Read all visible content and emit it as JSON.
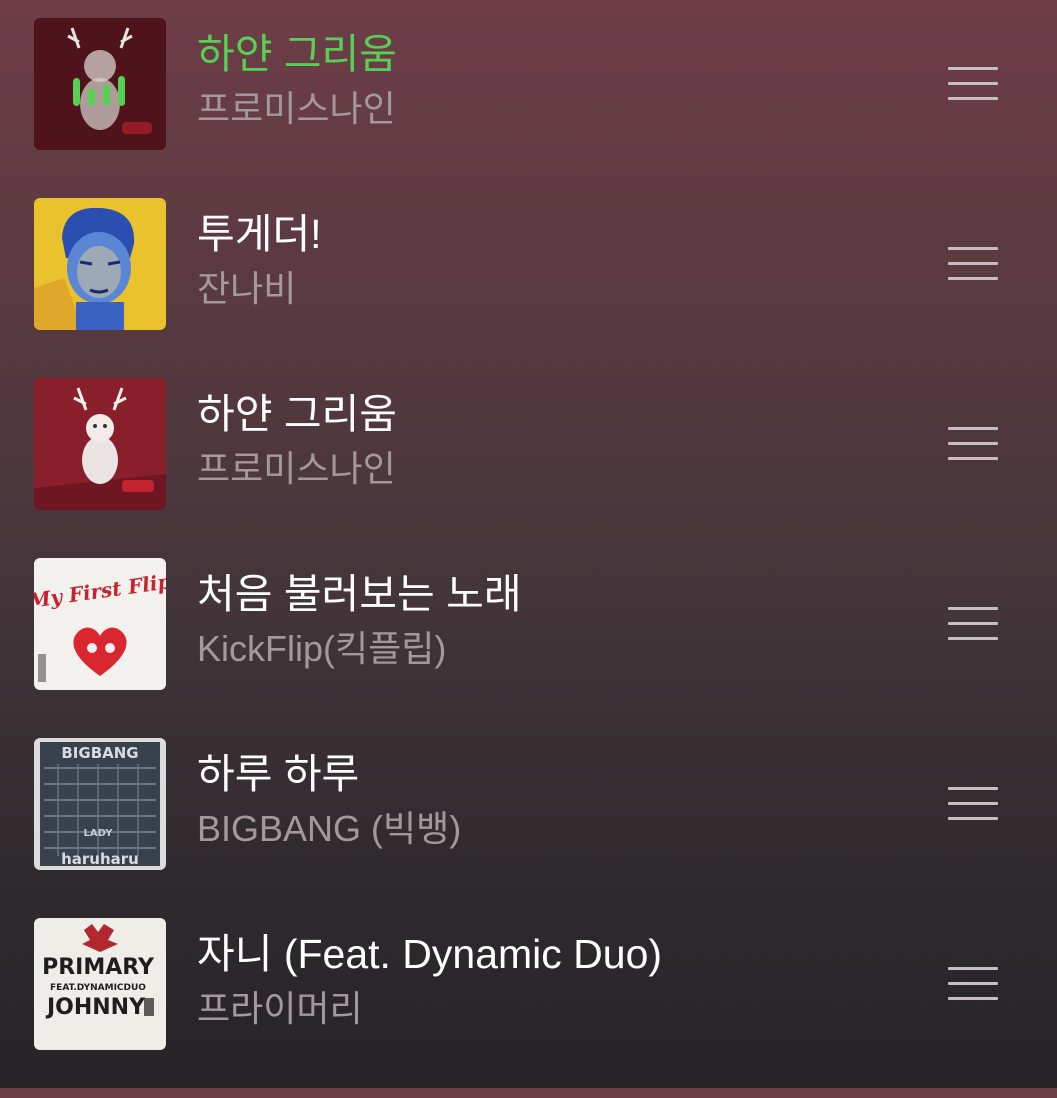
{
  "queue": {
    "items": [
      {
        "title": "하얀 그리움",
        "artist": "프로미스나인",
        "now_playing": true,
        "art": "white-cat-antlers-red"
      },
      {
        "title": "투게더!",
        "artist": "잔나비",
        "now_playing": false,
        "art": "blue-boy-painting-yellow"
      },
      {
        "title": "하얀 그리움",
        "artist": "프로미스나인",
        "now_playing": false,
        "art": "white-cat-antlers-red"
      },
      {
        "title": "처음 불러보는 노래",
        "artist": "KickFlip(킥플립)",
        "now_playing": false,
        "art": "red-skateboard-heart-white"
      },
      {
        "title": "하루 하루",
        "artist": "BIGBANG (빅뱅)",
        "now_playing": false,
        "art": "bigbang-haruharu-grey"
      },
      {
        "title": "자니 (Feat. Dynamic Duo)",
        "artist": "프라이머리",
        "now_playing": false,
        "art": "primary-johnny-white"
      }
    ],
    "art_text": {
      "item4_cover_text": "My First Flip",
      "item5_cover_top": "BIGBANG",
      "item5_cover_bottom": "haruharu",
      "item5_cover_middle": "LADY",
      "item6_cover_line1": "PRIMARY",
      "item6_cover_line2": "FEAT.DYNAMICDUO",
      "item6_cover_line3": "JOHNNY"
    }
  },
  "colors": {
    "now_playing_accent": "#57d154",
    "title_text": "#ffffff",
    "artist_text": "#a3989b"
  },
  "icons": {
    "playing_indicator": "equalizer-bars-icon",
    "reorder": "drag-handle-icon"
  }
}
